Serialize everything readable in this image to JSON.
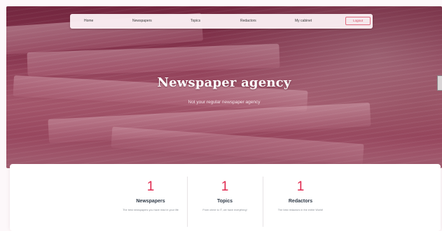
{
  "nav": {
    "items": [
      {
        "label": "Home"
      },
      {
        "label": "Newspapers"
      },
      {
        "label": "Topics"
      },
      {
        "label": "Redactors"
      },
      {
        "label": "My cabinet"
      }
    ],
    "logout_label": "Logout"
  },
  "hero": {
    "title": "Newspaper agency",
    "subtitle": "Not your regular newspaper agency"
  },
  "stats": [
    {
      "count": "1",
      "label": "Newspapers",
      "description": "The best newspapers you have read in your life"
    },
    {
      "count": "1",
      "label": "Topics",
      "description": "From crime to IT, we have everything!"
    },
    {
      "count": "1",
      "label": "Redactors",
      "description": "The best redactors in the entire World!"
    }
  ],
  "colors": {
    "accent": "#e0294f",
    "hero_tint": "#8e3c55",
    "nav_bg": "#faeef2"
  }
}
